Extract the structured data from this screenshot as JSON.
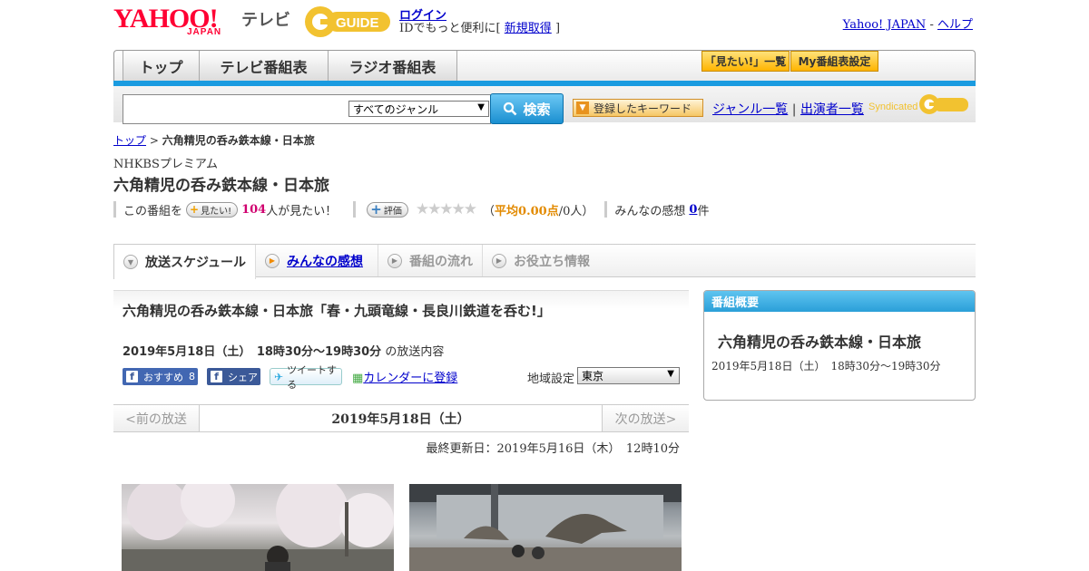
{
  "header": {
    "yahoo_logo": "YAHOO!",
    "japan_logo": "JAPAN",
    "tv_label": "テレビ",
    "gguide_logo": "GUIDE",
    "login_label": "ログイン",
    "login_note_prefix": "IDでもっと便利に[",
    "signup_label": "新規取得",
    "login_note_suffix": "]",
    "yahoo_japan_link": "Yahoo! JAPAN",
    "link_sep": "-",
    "help_link": "ヘルプ"
  },
  "nav": {
    "tabs": [
      {
        "label": "トップ"
      },
      {
        "label": "テレビ番組表"
      },
      {
        "label": "ラジオ番組表"
      }
    ],
    "want_list_btn": "「見たい!」一覧",
    "my_schedule_btn": "My番組表設定"
  },
  "search": {
    "genre_selected": "すべてのジャンル",
    "search_btn": "検索",
    "keyword_btn": "登録したキーワード",
    "genre_list_link": "ジャンル一覧",
    "link_sep": "|",
    "performers_link": "出演者一覧",
    "syndicated": "Syndicated"
  },
  "breadcrumb": {
    "top": "トップ",
    "sep": ">",
    "current": "六角精児の呑み鉄本線・日本旅"
  },
  "program": {
    "channel": "NHKBSプレミアム",
    "title": "六角精児の呑み鉄本線・日本旅",
    "this_program": "この番組を",
    "want_btn": "見たい!",
    "want_count": "104",
    "want_suffix": "人が見たい！",
    "rate_btn": "評価",
    "stars": "★★★★★",
    "rating_open": "（",
    "rating_avg": "平均0.00点",
    "rating_people": "/0人）",
    "impressions_label": "みんなの感想",
    "impressions_count": "0",
    "impressions_suffix": "件"
  },
  "tabs": [
    {
      "label": "放送スケジュール"
    },
    {
      "label": "みんなの感想"
    },
    {
      "label": "番組の流れ"
    },
    {
      "label": "お役立ち情報"
    }
  ],
  "episode": {
    "title": "六角精児の呑み鉄本線・日本旅「春・九頭竜線・長良川鉄道を呑む!」",
    "date_time": "2019年5月18日（土）　18時30分～19時30分",
    "date_suffix": "の放送内容",
    "fb_recommend": "おすすめ",
    "fb_recommend_count": "8",
    "fb_share": "シェア",
    "tweet": "ツイートする",
    "calendar": "カレンダーに登録",
    "region_label": "地域設定",
    "region_selected": "東京",
    "prev": "<前の放送",
    "bar_date": "2019年5月18日（土）",
    "next": "次の放送>",
    "updated": "最終更新日：2019年5月16日（木）　12時10分"
  },
  "sidebar": {
    "heading": "番組概要",
    "title": "六角精児の呑み鉄本線・日本旅",
    "date": "2019年5月18日（土）　18時30分～19時30分"
  },
  "colors": {
    "accent_blue": "#1a9be0",
    "yahoo_red": "#ff0033",
    "gguide_yellow": "#f2c230",
    "want_count": "#d0006f",
    "rating_avg": "#e28a00"
  }
}
